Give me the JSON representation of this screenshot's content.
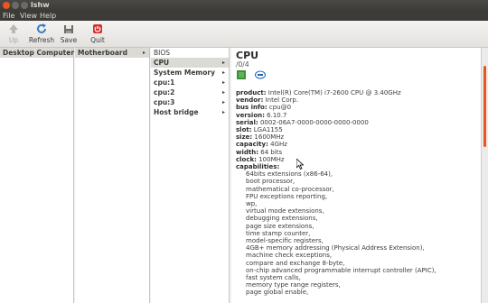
{
  "window": {
    "title": "lshw"
  },
  "menu": {
    "file": "File",
    "view": "View",
    "help": "Help"
  },
  "toolbar": {
    "up": "Up",
    "refresh": "Refresh",
    "save": "Save",
    "quit": "Quit"
  },
  "columns": {
    "col1": [
      {
        "label": "Desktop Computer"
      }
    ],
    "col2": [
      {
        "label": "Motherboard"
      }
    ],
    "col3": [
      {
        "label": "BIOS"
      },
      {
        "label": "CPU"
      },
      {
        "label": "System Memory"
      },
      {
        "label": "cpu:1"
      },
      {
        "label": "cpu:2"
      },
      {
        "label": "cpu:3"
      },
      {
        "label": "Host bridge"
      }
    ]
  },
  "detail": {
    "title": "CPU",
    "path": "/0/4",
    "properties": [
      {
        "key": "product:",
        "value": "Intel(R) Core(TM) i7-2600 CPU @ 3.40GHz"
      },
      {
        "key": "vendor:",
        "value": "Intel Corp."
      },
      {
        "key": "bus info:",
        "value": "cpu@0"
      },
      {
        "key": "version:",
        "value": "6.10.7"
      },
      {
        "key": "serial:",
        "value": "0002-06A7-0000-0000-0000-0000"
      },
      {
        "key": "slot:",
        "value": "LGA1155"
      },
      {
        "key": "size:",
        "value": "1600MHz"
      },
      {
        "key": "capacity:",
        "value": "4GHz"
      },
      {
        "key": "width:",
        "value": "64 bits"
      },
      {
        "key": "clock:",
        "value": "100MHz"
      },
      {
        "key": "capabilities:",
        "value": ""
      }
    ],
    "capabilities": [
      "64bits extensions (x86-64),",
      "boot processor,",
      "mathematical co-processor,",
      "FPU exceptions reporting,",
      "wp,",
      "virtual mode extensions,",
      "debugging extensions,",
      "page size extensions,",
      "time stamp counter,",
      "model-specific registers,",
      "4GB+ memory addressing (Physical Address Extension),",
      "machine check exceptions,",
      "compare and exchange 8-byte,",
      "on-chip advanced programmable interrupt controller (APIC),",
      "fast system calls,",
      "memory type range registers,",
      "page global enable,"
    ]
  }
}
